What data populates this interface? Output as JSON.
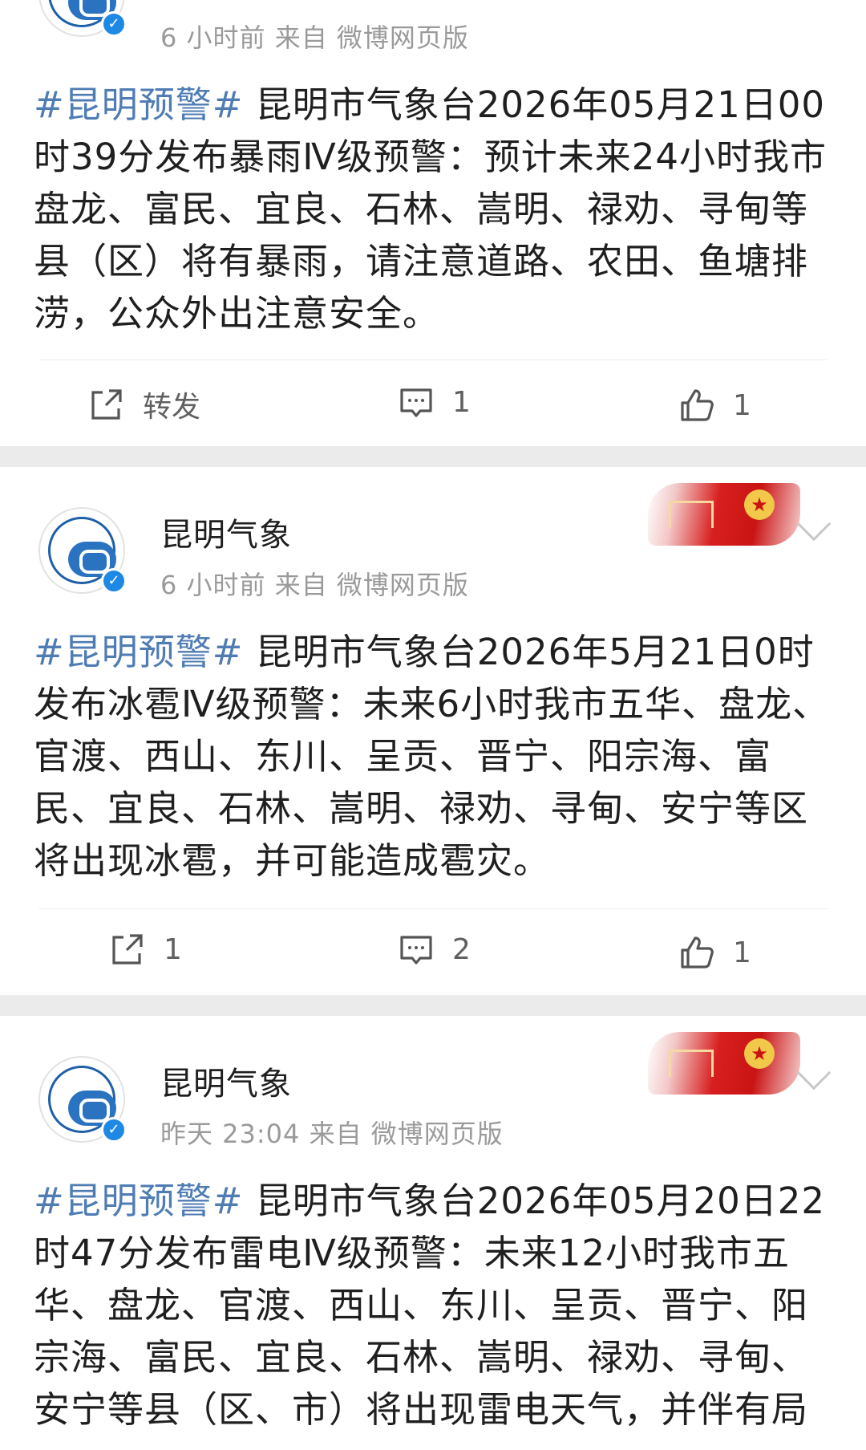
{
  "posts": [
    {
      "username": "",
      "meta": "6 小时前  来自 微博网页版",
      "hashtag": "#昆明预警#",
      "text": " 昆明市气象台2026年05月21日00时39分发布暴雨Ⅳ级预警：预计未来24小时我市盘龙、富民、宜良、石林、嵩明、禄劝、寻甸等县（区）将有暴雨，请注意道路、农田、鱼塘排涝，公众外出注意安全。",
      "repost_label": "转发",
      "comment_count": "1",
      "like_count": "1"
    },
    {
      "username": "昆明气象",
      "meta": "6 小时前  来自 微博网页版",
      "hashtag": "#昆明预警#",
      "text": " 昆明市气象台2026年5月21日0时发布冰雹Ⅳ级预警：未来6小时我市五华、盘龙、官渡、西山、东川、呈贡、晋宁、阳宗海、富民、宜良、石林、嵩明、禄劝、寻甸、安宁等区将出现冰雹，并可能造成雹灾。",
      "repost_label": "1",
      "comment_count": "2",
      "like_count": "1"
    },
    {
      "username": "昆明气象",
      "meta": "昨天 23:04  来自 微博网页版",
      "hashtag": "#昆明预警#",
      "text": " 昆明市气象台2026年05月20日22时47分发布雷电Ⅳ级预警：未来12小时我市五华、盘龙、官渡、西山、东川、呈贡、晋宁、阳宗海、富民、宜良、石林、嵩明、禄劝、寻甸、安宁等县（区、市）将出现雷电天气，并伴有局"
    }
  ],
  "icons": {
    "repost": "share-icon",
    "comment": "comment-icon",
    "like": "thumbs-up-icon",
    "verified": "verified-badge-icon",
    "more": "chevron-down-icon"
  },
  "colors": {
    "hashtag": "#4f7cb3",
    "verified": "#1e88e5",
    "meta": "#9a9a9a"
  }
}
